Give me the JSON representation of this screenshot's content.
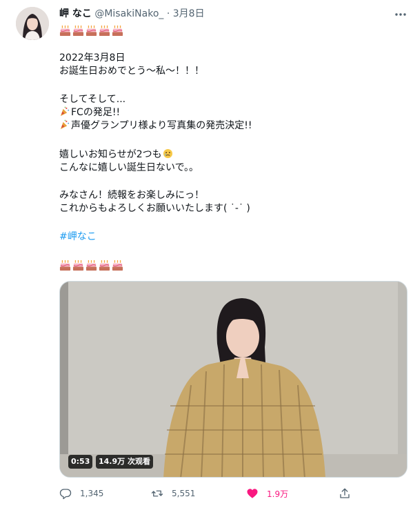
{
  "tweet": {
    "display_name": "岬 なこ",
    "handle": "@MisakiNako_",
    "separator": "·",
    "date": "3月8日",
    "lines": {
      "l1": "2022年3月8日",
      "l2": "お誕生日おめでとう〜私〜！！！",
      "l3": "そしてそして...",
      "l4": "FCの発足!!",
      "l5": "声優グランプリ様より写真集の発売決定!!",
      "l6": "嬉しいお知らせが2つも",
      "l7": "こんなに嬉しい誕生日ないで。。",
      "l8": "みなさん！続報をお楽しみにっ！",
      "l9": "これからもよろしくお願いいたします( ˙-˙ )"
    },
    "hashtag": "#岬なこ",
    "video": {
      "duration": "0:53",
      "views": "14.9万 次观看"
    },
    "actions": {
      "replies": "1,345",
      "retweets": "5,551",
      "likes": "1.9万"
    },
    "colors": {
      "accent": "#1d9bf0",
      "like": "#f91880",
      "muted": "#536471"
    }
  }
}
